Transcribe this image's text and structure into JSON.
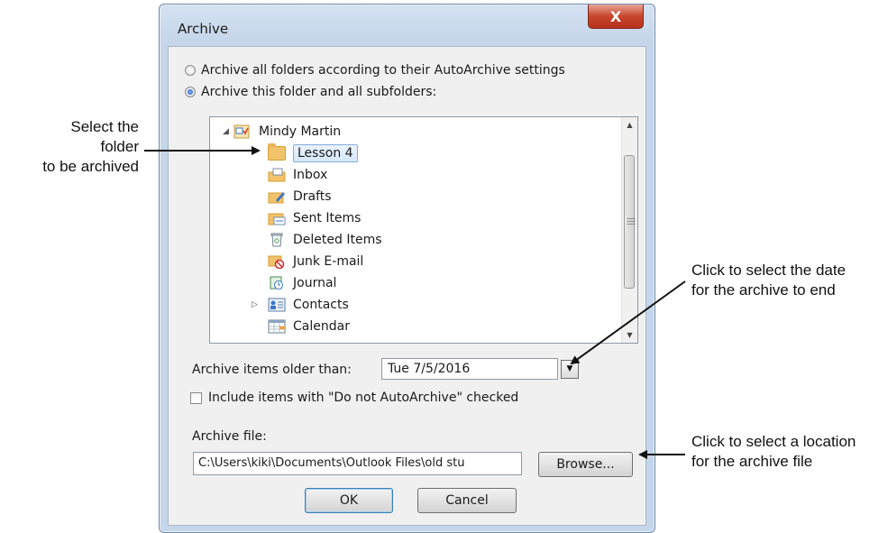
{
  "dialog": {
    "title": "Archive",
    "close_label": "X"
  },
  "options": {
    "all_folders_label": "Archive all folders according to their AutoArchive settings",
    "this_folder_label": "Archive this folder and all subfolders:",
    "selected": "this_folder"
  },
  "tree": {
    "root": "Mindy Martin",
    "items": [
      {
        "label": "Lesson 4",
        "icon": "folder-icon"
      },
      {
        "label": "Inbox",
        "icon": "inbox-icon"
      },
      {
        "label": "Drafts",
        "icon": "drafts-icon"
      },
      {
        "label": "Sent Items",
        "icon": "sent-items-icon"
      },
      {
        "label": "Deleted Items",
        "icon": "deleted-items-icon"
      },
      {
        "label": "Junk E-mail",
        "icon": "junk-email-icon"
      },
      {
        "label": "Journal",
        "icon": "journal-icon"
      },
      {
        "label": "Contacts",
        "icon": "contacts-icon"
      },
      {
        "label": "Calendar",
        "icon": "calendar-icon"
      }
    ],
    "selected": "Lesson 4"
  },
  "archive_older": {
    "label": "Archive items older than:",
    "value": "Tue 7/5/2016"
  },
  "include_checkbox": {
    "label": "Include items with \"Do not AutoArchive\" checked",
    "checked": false
  },
  "archive_file": {
    "label": "Archive file:",
    "value": "C:\\Users\\kiki\\Documents\\Outlook Files\\old stu",
    "browse_label": "Browse..."
  },
  "buttons": {
    "ok": "OK",
    "cancel": "Cancel"
  },
  "callouts": {
    "folder_line1": "Select the folder",
    "folder_line2": "to be archived",
    "date_line1": "Click to select the date",
    "date_line2": "for the archive to end",
    "location_line1": "Click to select a location",
    "location_line2": "for the archive file"
  },
  "colors": {
    "title_bar": "#c6d6ea",
    "close_button": "#c8462d",
    "selection": "#d6e8fb"
  }
}
